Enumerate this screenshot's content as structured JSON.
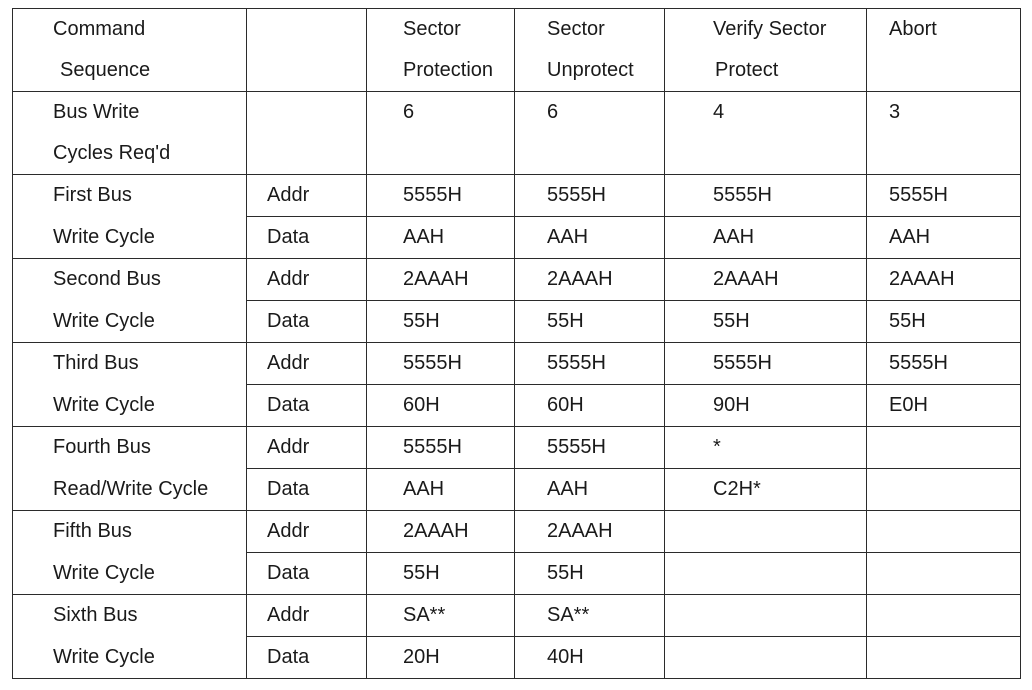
{
  "table": {
    "header": {
      "line1": [
        "Command",
        "",
        "Sector",
        "Sector",
        "Verify Sector",
        "Abort"
      ],
      "line2": [
        "Sequence",
        "",
        "Protection",
        "Unprotect",
        "Protect",
        ""
      ]
    },
    "bus_write_cycles": {
      "line1": [
        "Bus Write",
        "",
        "6",
        "6",
        "4",
        "3"
      ],
      "line2": [
        "Cycles Req'd",
        "",
        "",
        "",
        "",
        ""
      ]
    },
    "cycles": [
      {
        "label_line1": "First Bus",
        "label_line2": "Write Cycle",
        "addr_label": "Addr",
        "data_label": "Data",
        "addr": [
          "5555H",
          "5555H",
          "5555H",
          "5555H"
        ],
        "data": [
          "AAH",
          "AAH",
          "AAH",
          "AAH"
        ]
      },
      {
        "label_line1": "Second Bus",
        "label_line2": "Write Cycle",
        "addr_label": "Addr",
        "data_label": "Data",
        "addr": [
          "2AAAH",
          "2AAAH",
          "2AAAH",
          "2AAAH"
        ],
        "data": [
          "55H",
          "55H",
          "55H",
          "55H"
        ]
      },
      {
        "label_line1": "Third Bus",
        "label_line2": "Write Cycle",
        "addr_label": "Addr",
        "data_label": "Data",
        "addr": [
          "5555H",
          "5555H",
          "5555H",
          "5555H"
        ],
        "data": [
          "60H",
          "60H",
          "90H",
          "E0H"
        ]
      },
      {
        "label_line1": "Fourth Bus",
        "label_line2": "Read/Write Cycle",
        "addr_label": "Addr",
        "data_label": "Data",
        "addr": [
          "5555H",
          "5555H",
          "*",
          ""
        ],
        "data": [
          "AAH",
          "AAH",
          "C2H*",
          ""
        ]
      },
      {
        "label_line1": "Fifth Bus",
        "label_line2": "Write Cycle",
        "addr_label": "Addr",
        "data_label": "Data",
        "addr": [
          "2AAAH",
          "2AAAH",
          "",
          ""
        ],
        "data": [
          "55H",
          "55H",
          "",
          ""
        ]
      },
      {
        "label_line1": "Sixth Bus",
        "label_line2": "Write Cycle",
        "addr_label": "Addr",
        "data_label": "Data",
        "addr": [
          "SA**",
          "SA**",
          "",
          ""
        ],
        "data": [
          "20H",
          "40H",
          "",
          ""
        ]
      }
    ]
  }
}
